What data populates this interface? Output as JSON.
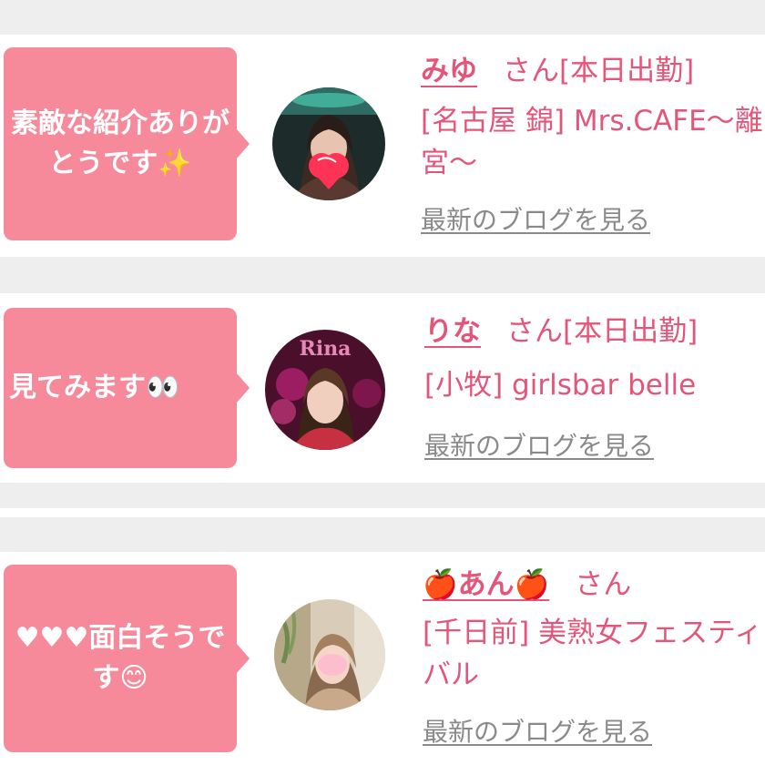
{
  "colors": {
    "bubble": "#f6899a",
    "accent": "#e4557a",
    "separator": "#eeeeee",
    "link_gray": "#8a8a8a"
  },
  "entries": [
    {
      "comment": "素敵な紹介ありがとうです✨",
      "name": "みゆ",
      "honorific": "さん[本日出勤]",
      "shop": "[名古屋 錦] Mrs.CAFE～離宮～",
      "blog_link": "最新のブログを見る"
    },
    {
      "comment": "見てみます👀",
      "name": "りな",
      "honorific": "さん[本日出勤]",
      "shop": "[小牧] girlsbar belle",
      "blog_link": "最新のブログを見る",
      "avatar_text": "Rina"
    },
    {
      "comment_hearts": "♥♥♥",
      "comment": "面白そうです😊",
      "name": "🍎あん🍎",
      "honorific": "さん",
      "shop": "[千日前] 美熟女フェスティバル",
      "blog_link": "最新のブログを見る"
    }
  ]
}
